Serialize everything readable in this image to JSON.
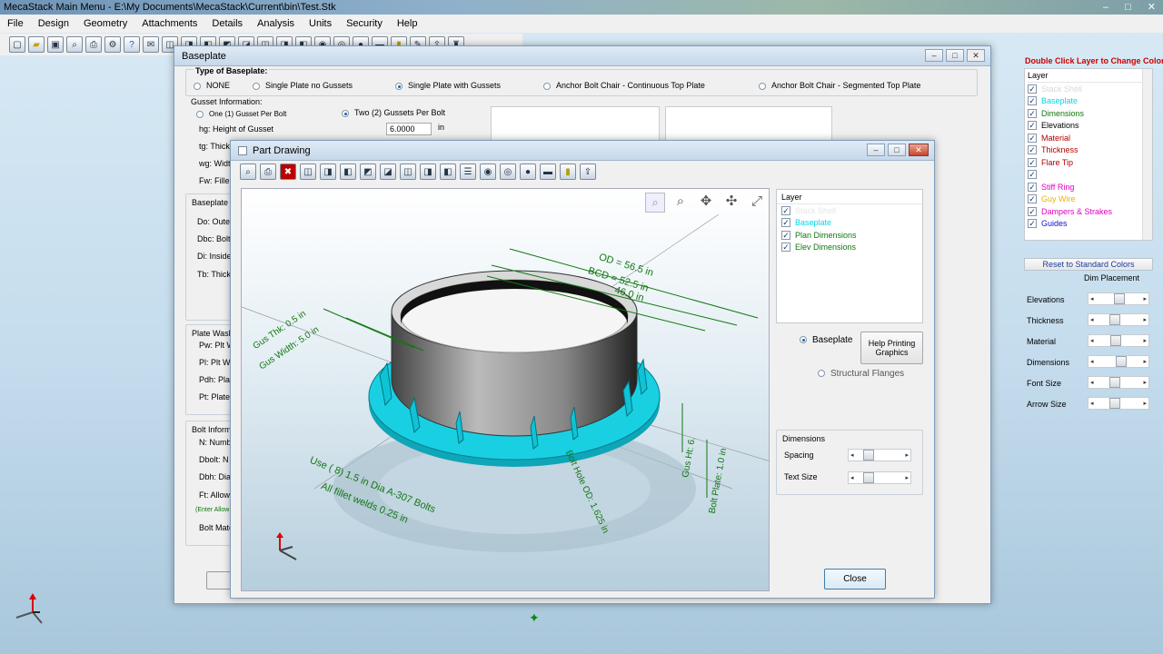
{
  "app": {
    "title": "MecaStack Main Menu - E:\\My Documents\\MecaStack\\Current\\bin\\Test.Stk"
  },
  "menu": [
    "File",
    "Design",
    "Geometry",
    "Attachments",
    "Details",
    "Analysis",
    "Units",
    "Security",
    "Help"
  ],
  "baseplate": {
    "title": "Baseplate",
    "type_header": "Type of Baseplate:",
    "types": [
      {
        "label": "NONE",
        "selected": false
      },
      {
        "label": "Single Plate no Gussets",
        "selected": false
      },
      {
        "label": "Single Plate with Gussets",
        "selected": true
      },
      {
        "label": "Anchor Bolt Chair - Continuous Top Plate",
        "selected": false
      },
      {
        "label": "Anchor Bolt Chair - Segmented Top Plate",
        "selected": false
      }
    ],
    "gusset_header": "Gusset Information:",
    "gusset_opts": [
      {
        "label": "One (1) Gusset Per Bolt",
        "selected": false
      },
      {
        "label": "Two (2) Gussets Per Bolt",
        "selected": true
      }
    ],
    "gusset_rows": [
      "hg: Height of Gusset",
      "tg: Thick",
      "wg: Widt",
      "Fw: Fille"
    ],
    "hg_value": "6.0000",
    "hg_unit": "in",
    "bp_header": "Baseplate",
    "bp_rows": [
      "Do: Oute",
      "Dbc: Bolt",
      "Di: Inside",
      "Tb: Thick"
    ],
    "washer_header": "Plate Wash",
    "washer_rows": [
      "Pw: Plt W",
      "Pl: Plt Wa",
      "Pdh: Plat",
      "Pt: Plate"
    ],
    "bolt_header": "Bolt Inform",
    "bolt_rows": [
      "N: Numb",
      "Dbolt: N",
      "Dbh: Dia",
      "Ft: Allow",
      "(Enter Allow",
      "Bolt Mate"
    ]
  },
  "part": {
    "title": "Part Drawing",
    "layer_header": "Layer",
    "layers": [
      {
        "label": "Stack Shell",
        "checked": true,
        "color": "#e6e6e6"
      },
      {
        "label": "Baseplate",
        "checked": true,
        "color": "#00d8e8"
      },
      {
        "label": "Plan Dimensions",
        "checked": true,
        "color": "#117711"
      },
      {
        "label": "Elev Dimensions",
        "checked": true,
        "color": "#117711"
      }
    ],
    "radio_baseplate": "Baseplate",
    "radio_flanges": "Structural Flanges",
    "help_btn": "Help Printing Graphics",
    "dims_header": "Dimensions",
    "spacing": "Spacing",
    "textsize": "Text Size",
    "close": "Close",
    "annot": {
      "od": "OD = 56.5 in",
      "bcd": "BCD = 52.5 in",
      "id": "46.0 in",
      "gthk": "Gus Thk: 0.5 in",
      "gwid": "Gus Width: 5.0 in",
      "bolts1": "Use ( 8) 1.5 in Dia A-307 Bolts",
      "bolts2": "All fillet welds 0.25 in",
      "bhole": "Bolt Hole OD: 1.625 in",
      "gusht": "Gus Ht: 6.",
      "bplate": "Bolt Plate: 1.0 in"
    }
  },
  "right": {
    "hint": "Double Click Layer to Change Color",
    "layer_header": "Layer",
    "layers": [
      {
        "label": "Stack Shell",
        "color": "#d8d8d8"
      },
      {
        "label": "Baseplate",
        "color": "#00d8e8"
      },
      {
        "label": "Dimensions",
        "color": "#117711"
      },
      {
        "label": "Elevations",
        "color": "#000000"
      },
      {
        "label": "Material",
        "color": "#b00000"
      },
      {
        "label": "Thickness",
        "color": "#b00000"
      },
      {
        "label": "Flare Tip",
        "color": "#b00000"
      },
      {
        "label": "",
        "color": "#000"
      },
      {
        "label": "Stiff Ring",
        "color": "#e000c0"
      },
      {
        "label": "Guy Wire",
        "color": "#f0b000"
      },
      {
        "label": "Dampers & Strakes",
        "color": "#e000c0"
      },
      {
        "label": "Guides",
        "color": "#1010d0"
      }
    ],
    "reset": "Reset to Standard Colors",
    "dimplace": "Dim Placement",
    "sliders": [
      {
        "label": "Elevations",
        "value": 0.5
      },
      {
        "label": "Thickness",
        "value": 0.35
      },
      {
        "label": "Material",
        "value": 0.4
      },
      {
        "label": "Dimensions",
        "value": 0.55
      },
      {
        "label": "Font Size",
        "value": 0.35
      },
      {
        "label": "Arrow Size",
        "value": 0.35
      }
    ]
  }
}
